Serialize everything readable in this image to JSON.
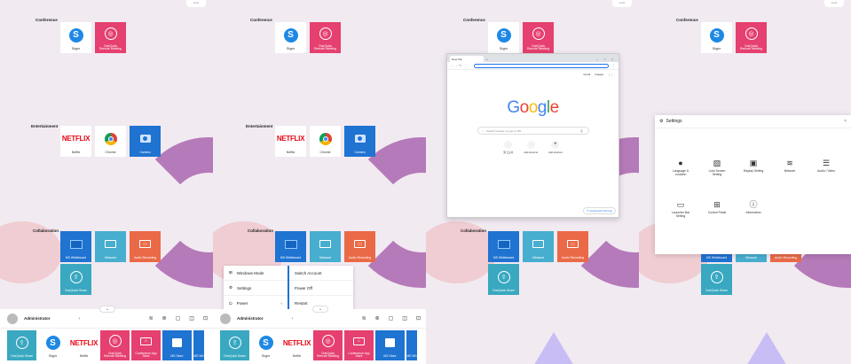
{
  "top_right_label": "Lock",
  "sections": {
    "conference": "Conference",
    "entertainment": "Entertainment",
    "collaboration": "Collaboration"
  },
  "apps": {
    "skype": "Skype",
    "onequick_remote": "OneQuick\nRemote Meeting",
    "netflix": "Netflix",
    "netflix_logo": "NETFLIX",
    "chrome": "Chrome",
    "camera": "Camera",
    "ms_whiteboard": "MS Whiteboard",
    "miracast": "Miracast",
    "audio_recording": "Audio Recording",
    "onequick_share": "OneQuick Share",
    "conference_app_store": "Conference App\nStore",
    "ms_store": "MS Store",
    "ms_wh_cut": "MS Wh"
  },
  "taskbar": {
    "admin": "Administrator"
  },
  "menu": {
    "windows_mode": "Windows Mode",
    "settings": "Settings",
    "power": "Power",
    "switch_account": "Switch Account",
    "power_off": "Power Off",
    "restart": "Restart"
  },
  "browser": {
    "tab_title": "New Tab",
    "search_placeholder": "Search Google or type a URL",
    "links": [
      "Gmail",
      "Images"
    ],
    "google_letters": [
      "G",
      "o",
      "o",
      "g",
      "l",
      "e"
    ],
    "shortcuts": [
      "웹 스토어",
      "Add shortcut",
      "Add shortcut"
    ],
    "customize": "Customize Chrome"
  },
  "settings": {
    "title": "Settings",
    "items": [
      "Language &\nLocation",
      "Lock Screen\nSetting",
      "Display Setting",
      "Network",
      "Audio / Video",
      "Launcher Bar\nSetting",
      "Control Panel",
      "Information"
    ]
  },
  "colors": {
    "bg": "#f1eaf1",
    "purple": "#b57ab9",
    "pink_tile": "#e5406f",
    "blue_tile": "#1f73d1",
    "orange_tile": "#ea6a48",
    "teal_tile": "#47aecf"
  }
}
